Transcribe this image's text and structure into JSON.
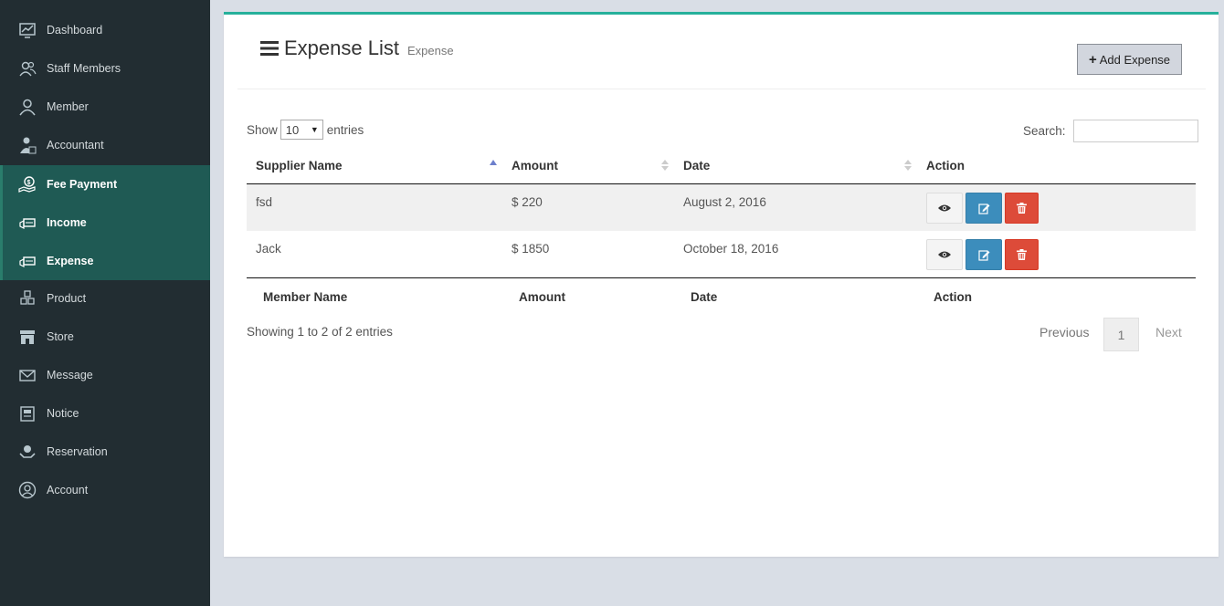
{
  "sidebar": {
    "items": [
      {
        "label": "Dashboard",
        "icon": "dashboard-icon",
        "active": false
      },
      {
        "label": "Staff Members",
        "icon": "staff-icon",
        "active": false
      },
      {
        "label": "Member",
        "icon": "user-icon",
        "active": false
      },
      {
        "label": "Accountant",
        "icon": "accountant-icon",
        "active": false
      },
      {
        "label": "Fee Payment",
        "icon": "fee-payment-icon",
        "active": true
      },
      {
        "label": "Income",
        "icon": "income-icon",
        "active": true
      },
      {
        "label": "Expense",
        "icon": "expense-icon",
        "active": true
      },
      {
        "label": "Product",
        "icon": "product-icon",
        "active": false
      },
      {
        "label": "Store",
        "icon": "store-icon",
        "active": false
      },
      {
        "label": "Message",
        "icon": "envelope-icon",
        "active": false
      },
      {
        "label": "Notice",
        "icon": "notice-icon",
        "active": false
      },
      {
        "label": "Reservation",
        "icon": "reservation-icon",
        "active": false
      },
      {
        "label": "Account",
        "icon": "account-icon",
        "active": false
      }
    ]
  },
  "header": {
    "title": "Expense List",
    "subtitle": "Expense",
    "add_button": "Add Expense"
  },
  "controls": {
    "show": "Show",
    "length_value": "10",
    "entries": "entries",
    "search_label": "Search:",
    "search_value": ""
  },
  "table": {
    "headers": [
      "Supplier Name",
      "Amount",
      "Date",
      "Action"
    ],
    "footers": [
      "Member Name",
      "Amount",
      "Date",
      "Action"
    ],
    "rows": [
      {
        "supplier": "fsd",
        "amount": "$ 220",
        "date": "August 2, 2016"
      },
      {
        "supplier": "Jack",
        "amount": "$ 1850",
        "date": "October 18, 2016"
      }
    ]
  },
  "footer": {
    "info": "Showing 1 to 2 of 2 entries",
    "previous": "Previous",
    "page": "1",
    "next": "Next"
  },
  "colors": {
    "sidebar_bg": "#222d32",
    "sidebar_active": "#1f5a54",
    "accent_top": "#26b09b",
    "edit_button": "#3c8dbc",
    "delete_button": "#dd4b39"
  }
}
